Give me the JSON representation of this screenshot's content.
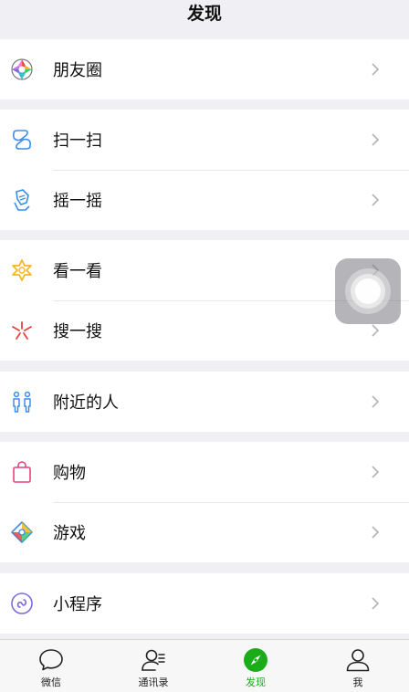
{
  "header": {
    "title": "发现"
  },
  "groups": [
    {
      "items": [
        {
          "label": "朋友圈",
          "icon": "moments-icon"
        }
      ]
    },
    {
      "items": [
        {
          "label": "扫一扫",
          "icon": "scan-icon"
        },
        {
          "label": "摇一摇",
          "icon": "shake-icon"
        }
      ]
    },
    {
      "items": [
        {
          "label": "看一看",
          "icon": "top-stories-icon"
        },
        {
          "label": "搜一搜",
          "icon": "search-icon"
        }
      ]
    },
    {
      "items": [
        {
          "label": "附近的人",
          "icon": "people-nearby-icon"
        }
      ]
    },
    {
      "items": [
        {
          "label": "购物",
          "icon": "shopping-bag-icon"
        },
        {
          "label": "游戏",
          "icon": "games-icon"
        }
      ]
    },
    {
      "items": [
        {
          "label": "小程序",
          "icon": "mini-programs-icon"
        }
      ]
    }
  ],
  "tabbar": {
    "tabs": [
      {
        "label": "微信",
        "icon": "chat-bubble-icon",
        "active": false
      },
      {
        "label": "通讯录",
        "icon": "contacts-icon",
        "active": false
      },
      {
        "label": "发现",
        "icon": "compass-icon",
        "active": true
      },
      {
        "label": "我",
        "icon": "profile-icon",
        "active": false
      }
    ]
  },
  "colors": {
    "accent": "#1aad19",
    "background": "#efeff4",
    "tabbar": "#f7f7f7"
  }
}
